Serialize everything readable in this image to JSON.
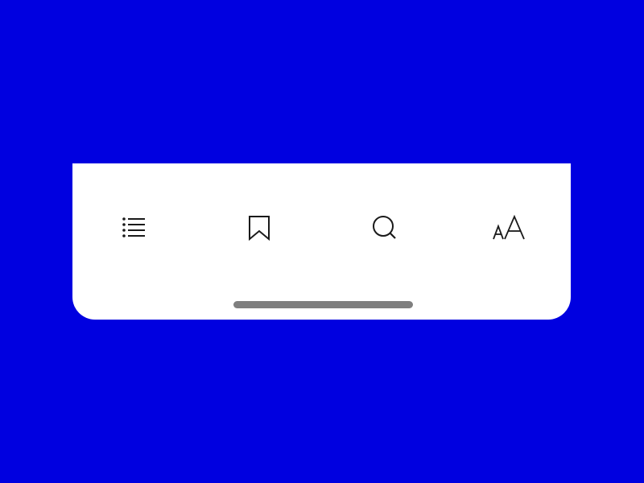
{
  "colors": {
    "background": "#0000E0",
    "toolbar": "#FFFFFF",
    "icon": "#1A1A1A",
    "home_indicator": "#7F7F7F"
  },
  "toolbar": {
    "items": [
      {
        "icon": "list-icon"
      },
      {
        "icon": "bookmark-icon"
      },
      {
        "icon": "search-icon"
      },
      {
        "icon": "text-size-icon"
      }
    ]
  }
}
